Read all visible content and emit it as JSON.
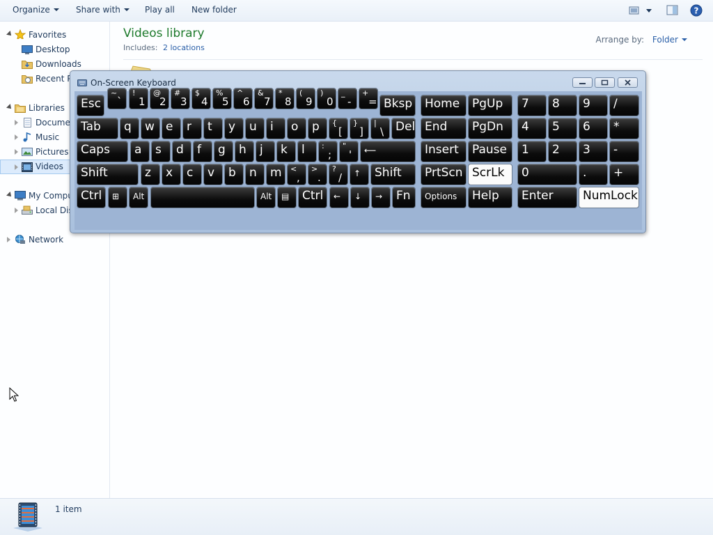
{
  "toolbar": {
    "organize": "Organize",
    "share_with": "Share with",
    "play_all": "Play all",
    "new_folder": "New folder"
  },
  "nav": {
    "favorites": "Favorites",
    "desktop": "Desktop",
    "downloads": "Downloads",
    "recent": "Recent Pl",
    "libraries": "Libraries",
    "documents": "Documen",
    "music": "Music",
    "pictures": "Pictures",
    "videos": "Videos",
    "computer": "My Compu",
    "local_disk": "Local Disk",
    "network": "Network"
  },
  "library": {
    "title": "Videos library",
    "includes_label": "Includes:",
    "includes_link": "2 locations",
    "arrange_label": "Arrange by:",
    "arrange_value": "Folder"
  },
  "status": {
    "count": "1 item"
  },
  "osk": {
    "title": "On-Screen Keyboard",
    "keys": [
      {
        "id": "esc",
        "main": "Esc"
      },
      {
        "id": "backtick",
        "shift": "~",
        "base": "`"
      },
      {
        "id": "1",
        "shift": "!",
        "base": "1"
      },
      {
        "id": "2",
        "shift": "@",
        "base": "2"
      },
      {
        "id": "3",
        "shift": "#",
        "base": "3"
      },
      {
        "id": "4",
        "shift": "$",
        "base": "4"
      },
      {
        "id": "5",
        "shift": "%",
        "base": "5"
      },
      {
        "id": "6",
        "shift": "^",
        "base": "6"
      },
      {
        "id": "7",
        "shift": "&",
        "base": "7"
      },
      {
        "id": "8",
        "shift": "*",
        "base": "8"
      },
      {
        "id": "9",
        "shift": "(",
        "base": "9"
      },
      {
        "id": "0",
        "shift": ")",
        "base": "0"
      },
      {
        "id": "minus",
        "shift": "_",
        "base": "-"
      },
      {
        "id": "equals",
        "shift": "+",
        "base": "="
      },
      {
        "id": "bksp",
        "main": "Bksp"
      },
      {
        "id": "home",
        "main": "Home"
      },
      {
        "id": "pgup",
        "main": "PgUp"
      },
      {
        "id": "np7",
        "main": "7"
      },
      {
        "id": "np8",
        "main": "8"
      },
      {
        "id": "np9",
        "main": "9"
      },
      {
        "id": "npslash",
        "main": "/"
      },
      {
        "id": "tab",
        "main": "Tab"
      },
      {
        "id": "q",
        "main": "q"
      },
      {
        "id": "w",
        "main": "w"
      },
      {
        "id": "e",
        "main": "e"
      },
      {
        "id": "r",
        "main": "r"
      },
      {
        "id": "t",
        "main": "t"
      },
      {
        "id": "y",
        "main": "y"
      },
      {
        "id": "u",
        "main": "u"
      },
      {
        "id": "i",
        "main": "i"
      },
      {
        "id": "o",
        "main": "o"
      },
      {
        "id": "p",
        "main": "p"
      },
      {
        "id": "lbracket",
        "shift": "{",
        "base": "["
      },
      {
        "id": "rbracket",
        "shift": "}",
        "base": "]"
      },
      {
        "id": "backslash",
        "shift": "|",
        "base": "\\"
      },
      {
        "id": "del",
        "main": "Del"
      },
      {
        "id": "end",
        "main": "End"
      },
      {
        "id": "pgdn",
        "main": "PgDn"
      },
      {
        "id": "np4",
        "main": "4"
      },
      {
        "id": "np5",
        "main": "5"
      },
      {
        "id": "np6",
        "main": "6"
      },
      {
        "id": "npstar",
        "main": "*"
      },
      {
        "id": "caps",
        "main": "Caps"
      },
      {
        "id": "a",
        "main": "a"
      },
      {
        "id": "s",
        "main": "s"
      },
      {
        "id": "d",
        "main": "d"
      },
      {
        "id": "f",
        "main": "f"
      },
      {
        "id": "g",
        "main": "g"
      },
      {
        "id": "h",
        "main": "h"
      },
      {
        "id": "j",
        "main": "j"
      },
      {
        "id": "k",
        "main": "k"
      },
      {
        "id": "l",
        "main": "l"
      },
      {
        "id": "semicolon",
        "shift": ":",
        "base": ";"
      },
      {
        "id": "quote",
        "shift": "\"",
        "base": "'"
      },
      {
        "id": "enter-main",
        "main": "⟵",
        "small": true
      },
      {
        "id": "insert",
        "main": "Insert"
      },
      {
        "id": "pause",
        "main": "Pause"
      },
      {
        "id": "np1",
        "main": "1"
      },
      {
        "id": "np2",
        "main": "2"
      },
      {
        "id": "np3",
        "main": "3"
      },
      {
        "id": "npminus",
        "main": "-"
      },
      {
        "id": "lshift",
        "main": "Shift"
      },
      {
        "id": "z",
        "main": "z"
      },
      {
        "id": "x",
        "main": "x"
      },
      {
        "id": "c",
        "main": "c"
      },
      {
        "id": "v",
        "main": "v"
      },
      {
        "id": "b",
        "main": "b"
      },
      {
        "id": "n",
        "main": "n"
      },
      {
        "id": "m",
        "main": "m"
      },
      {
        "id": "comma",
        "shift": "<",
        "base": ","
      },
      {
        "id": "period",
        "shift": ">",
        "base": "."
      },
      {
        "id": "slash",
        "shift": "?",
        "base": "/"
      },
      {
        "id": "up",
        "main": "↑",
        "small": true
      },
      {
        "id": "rshift",
        "main": "Shift"
      },
      {
        "id": "prtscn",
        "main": "PrtScn"
      },
      {
        "id": "scrlk",
        "main": "ScrLk"
      },
      {
        "id": "np0",
        "main": "0"
      },
      {
        "id": "npdot",
        "main": "."
      },
      {
        "id": "npplus",
        "main": "+"
      },
      {
        "id": "lctrl",
        "main": "Ctrl"
      },
      {
        "id": "win",
        "main": "⊞",
        "small": true
      },
      {
        "id": "lalt",
        "main": "Alt",
        "small": true
      },
      {
        "id": "space",
        "main": ""
      },
      {
        "id": "ralt",
        "main": "Alt",
        "small": true
      },
      {
        "id": "menu",
        "main": "▤",
        "small": true
      },
      {
        "id": "rctrl",
        "main": "Ctrl"
      },
      {
        "id": "left",
        "main": "←",
        "small": true
      },
      {
        "id": "down",
        "main": "↓",
        "small": true
      },
      {
        "id": "right",
        "main": "→",
        "small": true
      },
      {
        "id": "fn",
        "main": "Fn"
      },
      {
        "id": "options",
        "main": "Options",
        "small": true
      },
      {
        "id": "help",
        "main": "Help"
      },
      {
        "id": "npenter",
        "main": "Enter"
      },
      {
        "id": "numlock",
        "main": "NumLock"
      }
    ]
  }
}
